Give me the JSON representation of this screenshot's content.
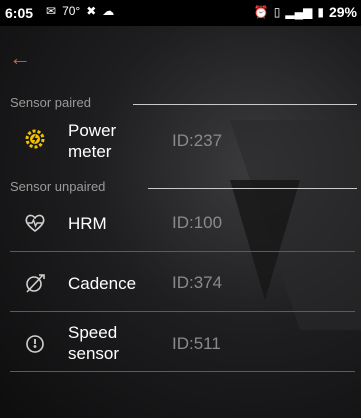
{
  "status_bar": {
    "time": "6:05",
    "temp": "70°",
    "battery": "29%"
  },
  "colors": {
    "accent": "#e8533b",
    "paired_icon": "#f2c200"
  },
  "sections": {
    "paired_label": "Sensor paired",
    "unpaired_label": "Sensor unpaired"
  },
  "paired_sensors": [
    {
      "name_line1": "Power",
      "name_line2": "meter",
      "id": "ID:237",
      "icon": "power-meter-icon"
    }
  ],
  "unpaired_sensors": [
    {
      "name_line1": "HRM",
      "id": "ID:100",
      "icon": "heart-rate-icon"
    },
    {
      "name_line1": "Cadence",
      "id": "ID:374",
      "icon": "cadence-icon"
    },
    {
      "name_line1": "Speed",
      "name_line2": "sensor",
      "id": "ID:511",
      "icon": "speed-icon"
    }
  ]
}
